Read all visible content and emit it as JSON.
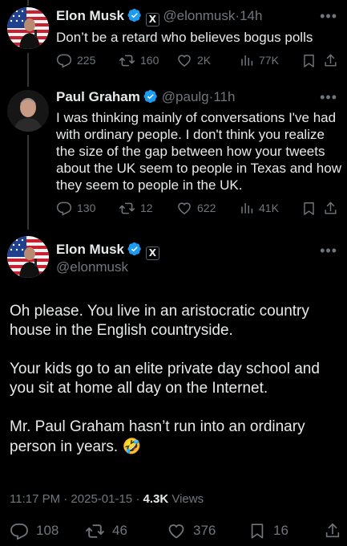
{
  "tweet1": {
    "name": "Elon Musk",
    "handle": "@elonmusk",
    "time": "14h",
    "text": "Don’t be a retard who believes bogus polls",
    "replies": "225",
    "retweets": "160",
    "likes": "2K",
    "views": "77K"
  },
  "tweet2": {
    "name": "Paul Graham",
    "handle": "@paulg",
    "time": "11h",
    "text_lines": [
      "I was thinking mainly of conversations I've had",
      "with ordinary people. I don't think you realize",
      "the size of the gap between how your tweets",
      "about the UK seem to people in Texas and how",
      "they seem to people in the UK."
    ],
    "replies": "130",
    "retweets": "12",
    "likes": "622",
    "views": "41K"
  },
  "main": {
    "name": "Elon Musk",
    "handle": "@elonmusk",
    "para1_lines": [
      "Oh please. You live in an aristocratic country",
      "house in the English countryside."
    ],
    "para2_lines": [
      "Your kids go to an elite private day school and",
      "you sit at home all day on the Internet."
    ],
    "para3_lines": [
      "Mr. Paul Graham hasn’t run into an ordinary",
      "person in years."
    ],
    "emoji": "🤣",
    "timestamp": "11:17 PM · 2025-01-15 ·",
    "views_count": "4.3K",
    "views_label": "Views",
    "replies": "108",
    "retweets": "46",
    "likes": "376",
    "bookmarks": "16"
  },
  "icons": {
    "verified": "verified-badge-icon",
    "affiliate": "x-affiliate-icon",
    "reply": "reply-icon",
    "retweet": "retweet-icon",
    "like": "heart-icon",
    "views": "views-icon",
    "bookmark": "bookmark-icon",
    "share": "share-icon",
    "more": "more-icon"
  },
  "colors": {
    "background": "#000000",
    "text": "#e7e9ea",
    "secondary": "#71767b",
    "verified": "#1d9bf0"
  },
  "x_glyph": "X",
  "more_glyph": "•••"
}
